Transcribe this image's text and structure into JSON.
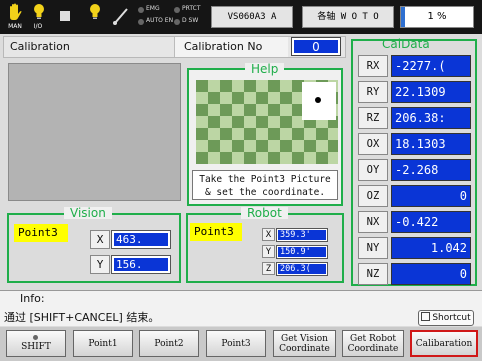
{
  "topbar": {
    "icons": [
      {
        "name": "hand-icon",
        "glyph": "✋",
        "label": "MAN"
      },
      {
        "name": "bulb-io-icon",
        "glyph": "💡",
        "label": "I/O"
      },
      {
        "name": "stop-square-icon",
        "glyph": "■",
        "label": ""
      },
      {
        "name": "lamp-icon",
        "glyph": "💡",
        "label": ""
      },
      {
        "name": "pen-icon",
        "glyph": "/",
        "label": ""
      }
    ],
    "indicators": [
      "EMG",
      "PRTCT",
      "AUTO EN",
      "D SW"
    ],
    "robot_model": "VS060A3 A",
    "axis_mode": "各轴  W O T O",
    "speed_percent": "1 %",
    "speed_fill": 0.05
  },
  "calibration": {
    "title": "Calibration",
    "no_label": "Calibration No",
    "no_value": "0"
  },
  "help": {
    "title": "Help",
    "text_line1": "Take the Point3 Picture",
    "text_line2": "& set the coordinate."
  },
  "vision": {
    "title": "Vision",
    "point_label": "Point3",
    "x_label": "X",
    "x_value": "463.",
    "y_label": "Y",
    "y_value": "156."
  },
  "robot": {
    "title": "Robot",
    "point_label": "Point3",
    "x_label": "X",
    "x_value": "359.3'",
    "y_label": "Y",
    "y_value": "150.9'",
    "z_label": "Z",
    "z_value": "206.3("
  },
  "caldata": {
    "title": "CalData",
    "rows": [
      {
        "label": "RX",
        "value": "-2277.("
      },
      {
        "label": "RY",
        "value": "22.1309"
      },
      {
        "label": "RZ",
        "value": "206.38:"
      },
      {
        "label": "OX",
        "value": "18.1303"
      },
      {
        "label": "OY",
        "value": "-2.268"
      },
      {
        "label": "OZ",
        "value": "0"
      },
      {
        "label": "NX",
        "value": "-0.422"
      },
      {
        "label": "NY",
        "value": "1.042"
      },
      {
        "label": "NZ",
        "value": "0"
      }
    ]
  },
  "info": {
    "label": "Info:",
    "message": "通过 [SHIFT+CANCEL] 结束。",
    "shortcut_label": "Shortcut"
  },
  "function_keys": [
    {
      "name": "shift-key",
      "line1": "SHIFT",
      "line2": ""
    },
    {
      "name": "point1-key",
      "line1": "Point1",
      "line2": ""
    },
    {
      "name": "point2-key",
      "line1": "Point2",
      "line2": ""
    },
    {
      "name": "point3-key",
      "line1": "Point3",
      "line2": ""
    },
    {
      "name": "get-vision-coordinate-key",
      "line1": "Get Vision",
      "line2": "Coordinate"
    },
    {
      "name": "get-robot-coordinate-key",
      "line1": "Get Robot",
      "line2": "Coordinate"
    },
    {
      "name": "calibration-key",
      "line1": "Calibaration",
      "line2": ""
    }
  ],
  "colors": {
    "accent_green": "#1fae4a",
    "value_blue": "#0a35d6",
    "label_yellow": "#ffff00",
    "highlight_red": "#d01818"
  }
}
